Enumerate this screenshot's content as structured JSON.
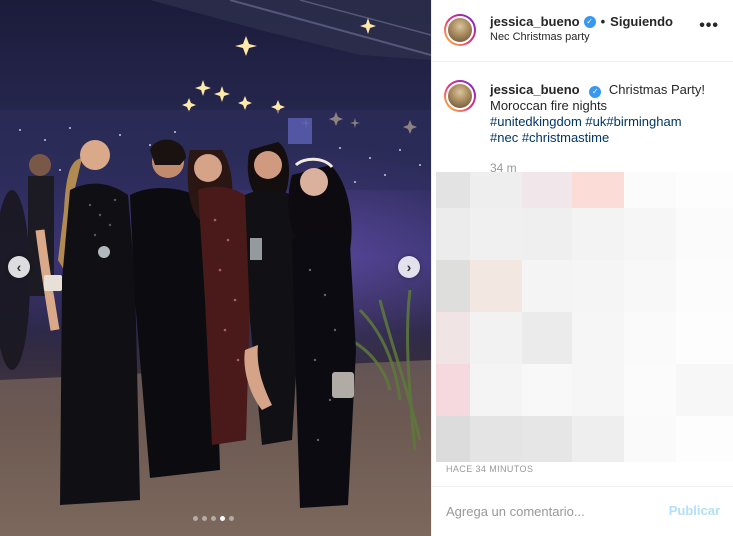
{
  "post": {
    "username": "jessica_bueno",
    "verified_icon": "verified-badge-icon",
    "separator": "•",
    "follow_status": "Siguiendo",
    "location": "Nec Christmas party",
    "more_icon": "more-options-icon",
    "more_glyph": "•••"
  },
  "caption": {
    "username": "jessica_bueno",
    "text": "Christmas Party! Moroccan fire nights",
    "hashtags": [
      "#unitedkingdom",
      "#uk",
      "#birmingham",
      "#nec",
      "#christmastime"
    ],
    "time_ago": "34 m"
  },
  "carousel": {
    "prev_glyph": "‹",
    "next_glyph": "›",
    "slide_count": 5,
    "active_index": 3
  },
  "timestamp": "HACE 34 MINUTOS",
  "comment": {
    "placeholder": "Agrega un comentario...",
    "publish_label": "Publicar"
  },
  "colors": {
    "accent": "#3897f0",
    "hashtag": "#003569",
    "publish_disabled": "#b2dffc",
    "muted_text": "#999999"
  }
}
